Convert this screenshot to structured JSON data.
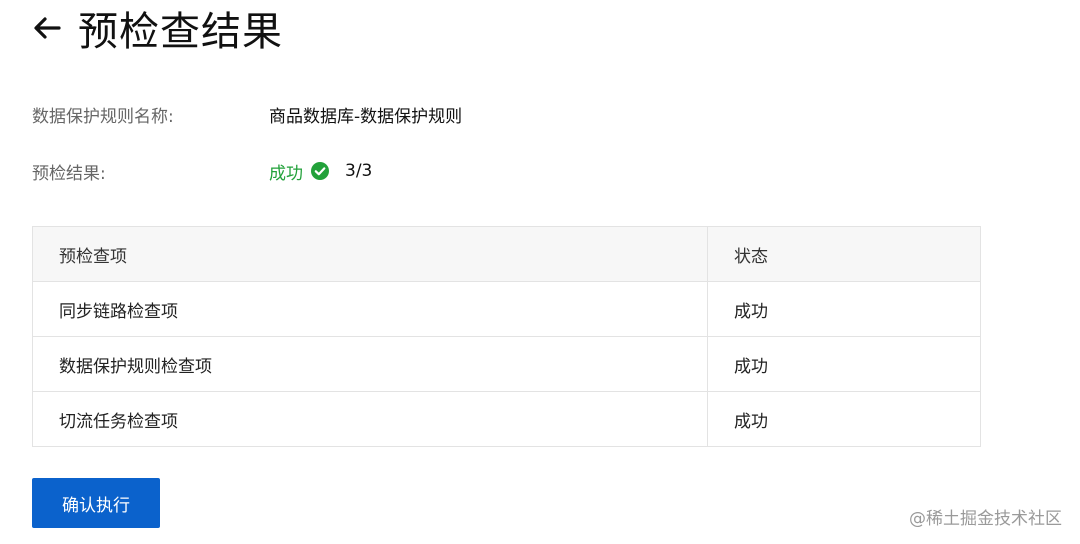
{
  "header": {
    "title": "预检查结果",
    "back_icon": "arrow-left-icon"
  },
  "info": {
    "rule_name_label": "数据保护规则名称:",
    "rule_name_value": "商品数据库-数据保护规则",
    "result_label": "预检结果:",
    "result_status": "成功",
    "result_icon": "check-circle-icon",
    "result_score": "3/3"
  },
  "table": {
    "columns": [
      "预检查项",
      "状态"
    ],
    "rows": [
      {
        "item": "同步链路检查项",
        "status": "成功"
      },
      {
        "item": "数据保护规则检查项",
        "status": "成功"
      },
      {
        "item": "切流任务检查项",
        "status": "成功"
      }
    ]
  },
  "actions": {
    "confirm_label": "确认执行"
  },
  "watermark": "@稀土掘金技术社区",
  "colors": {
    "success": "#22a13a",
    "primary": "#0b62cc",
    "header_bg": "#f7f7f7"
  }
}
